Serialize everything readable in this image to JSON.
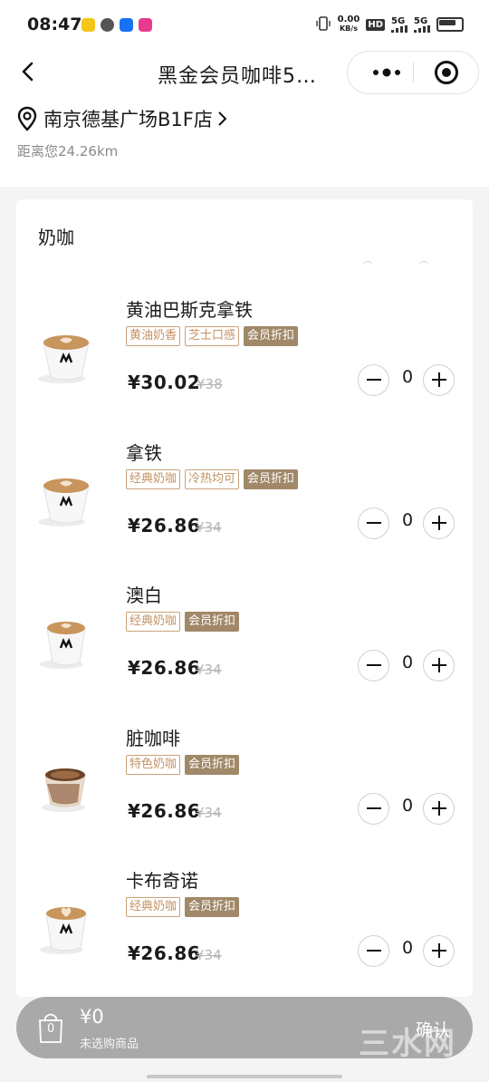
{
  "status_bar": {
    "time": "08:47",
    "net_speed_value": "0.00",
    "net_speed_unit": "KB/s",
    "hd": "HD",
    "signal1": "5G",
    "signal2": "5G"
  },
  "header": {
    "title": "黑金会员咖啡5…",
    "store_name": "南京德基广场B1F店",
    "distance": "距离您24.26km"
  },
  "menu": {
    "category": "奶咖",
    "products": [
      {
        "name": "黄油巴斯克拿铁",
        "tags": [
          "黄油奶香",
          "芝士口感"
        ],
        "member_tag": "会员折扣",
        "price": "¥30.02",
        "original_price": "¥38",
        "qty": "0"
      },
      {
        "name": "拿铁",
        "tags": [
          "经典奶咖",
          "冷热均可"
        ],
        "member_tag": "会员折扣",
        "price": "¥26.86",
        "original_price": "¥34",
        "qty": "0"
      },
      {
        "name": "澳白",
        "tags": [
          "经典奶咖"
        ],
        "member_tag": "会员折扣",
        "price": "¥26.86",
        "original_price": "¥34",
        "qty": "0"
      },
      {
        "name": "脏咖啡",
        "tags": [
          "特色奶咖"
        ],
        "member_tag": "会员折扣",
        "price": "¥26.86",
        "original_price": "¥34",
        "qty": "0"
      },
      {
        "name": "卡布奇诺",
        "tags": [
          "经典奶咖"
        ],
        "member_tag": "会员折扣",
        "price": "¥26.86",
        "original_price": "¥34",
        "qty": "0"
      }
    ]
  },
  "cart": {
    "count": "0",
    "total": "¥0",
    "hint": "未选购商品",
    "confirm_label": "确认"
  },
  "watermark": "三水网",
  "colors": {
    "tag_border": "#c9a27a",
    "member_tag_bg": "#a08868",
    "cart_bar": "#a9a9a9"
  }
}
